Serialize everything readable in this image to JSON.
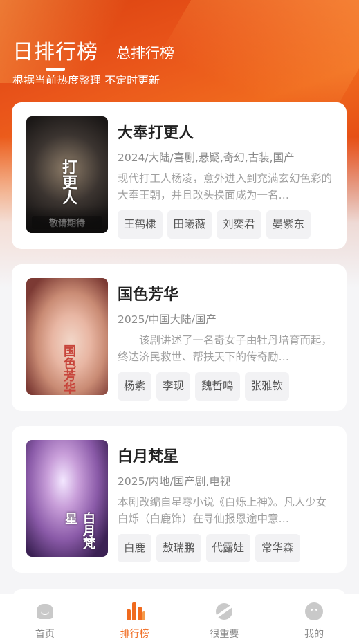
{
  "header": {
    "tab_active": "日排行榜",
    "tab_other": "总排行榜",
    "subtitle": "根据当前热度整理 不定时更新"
  },
  "items": [
    {
      "title": "大奉打更人",
      "meta": "2024/大陆/喜剧,悬疑,奇幻,古装,国产",
      "desc": "现代打工人杨凌，意外进入到充满玄幻色彩的大奉王朝，并且改头换面成为一名…",
      "poster_text": "打更人",
      "poster_tag": "敬请期待",
      "cast": [
        "王鹤棣",
        "田曦薇",
        "刘奕君",
        "晏紫东"
      ]
    },
    {
      "title": "国色芳华",
      "meta": "2025/中国大陆/国产",
      "desc": "　　该剧讲述了一名奇女子由牡丹培育而起，终达济民救世、帮扶天下的传奇励…",
      "poster_text": "国色芳华",
      "cast": [
        "杨紫",
        "李现",
        "魏哲鸣",
        "张雅钦"
      ]
    },
    {
      "title": "白月梵星",
      "meta": "2025/内地/国产剧,电视",
      "desc": "本剧改编自星零小说《白烁上神》。凡人少女白烁（白鹿饰）在寻仙报恩途中意…",
      "poster_text": "白月梵星",
      "cast": [
        "白鹿",
        "敖瑞鹏",
        "代露娃",
        "常华森"
      ]
    }
  ],
  "nav": [
    {
      "label": "首页",
      "icon": "home-icon"
    },
    {
      "label": "排行榜",
      "icon": "rank-icon"
    },
    {
      "label": "很重要",
      "icon": "planet-icon"
    },
    {
      "label": "我的",
      "icon": "me-icon"
    }
  ],
  "colors": {
    "accent": "#f06a1e",
    "header": "#e9541a"
  }
}
